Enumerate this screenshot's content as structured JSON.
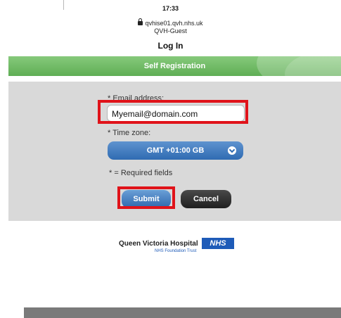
{
  "status_bar": {
    "time": "17:33"
  },
  "browser": {
    "domain": "qvhise01.qvh.nhs.uk",
    "network_name": "QVH-Guest",
    "lock_icon": "lock-icon"
  },
  "page": {
    "title": "Log In"
  },
  "banner": {
    "title": "Self Registration",
    "color": "#6cbb62"
  },
  "form": {
    "email_label": "* Email address:",
    "email_value": "Myemail@domain.com",
    "timezone_label": "* Time zone:",
    "timezone_value": "GMT +01:00 GB",
    "required_note": "* = Required fields",
    "submit_label": "Submit",
    "cancel_label": "Cancel",
    "highlight_color": "#e0131a",
    "accent_color": "#2f6bb2"
  },
  "footer": {
    "hospital_name": "Queen Victoria Hospital",
    "nhs_logo": "NHS",
    "trust_name": "NHS Foundation Trust"
  }
}
